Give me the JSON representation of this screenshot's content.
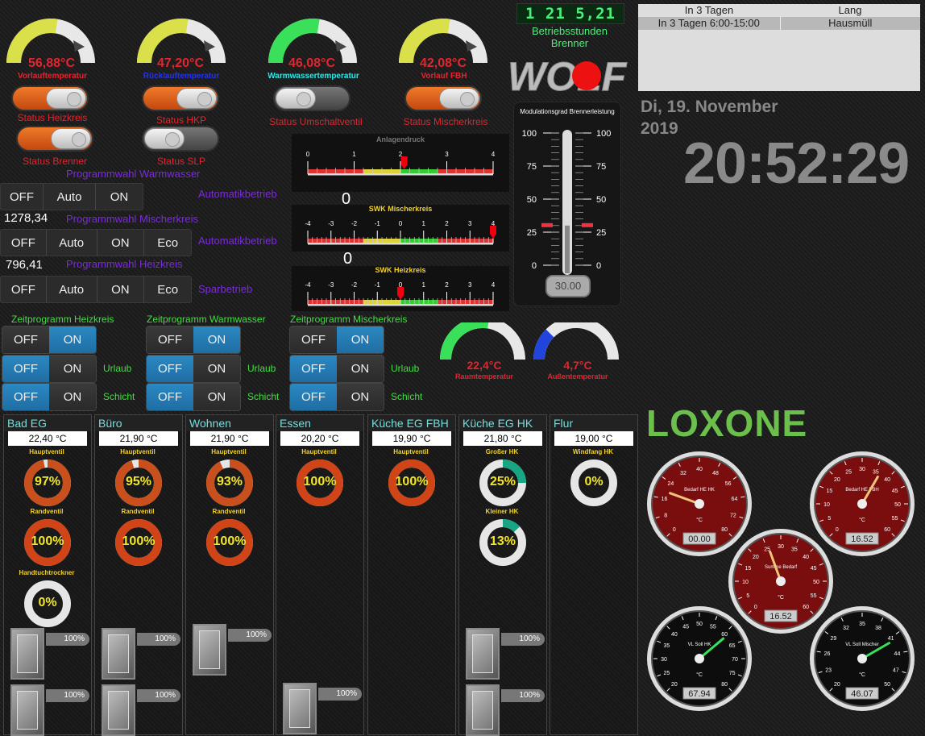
{
  "gauges_top": [
    {
      "value": "56,88°C",
      "label": "Vorlauftemperatur",
      "label_color": "#e0262f",
      "arc_color": "#d9e04a"
    },
    {
      "value": "47,20°C",
      "label": "Rücklauftemperatur",
      "label_color": "#2233ee",
      "arc_color": "#d9e04a"
    },
    {
      "value": "46,08°C",
      "label": "Warmwassertemperatur",
      "label_color": "#33e6e6",
      "arc_color": "#3be05a"
    },
    {
      "value": "42,08°C",
      "label": "Vorlauf FBH",
      "label_color": "#e0262f",
      "arc_color": "#d9e04a"
    }
  ],
  "status": {
    "heizkreis": "Status Heizkreis",
    "hkp": "Status HKP",
    "umschaltventil": "Status Umschaltventil",
    "mischerkreis": "Status Mischerkreis",
    "brenner": "Status Brenner",
    "slp": "Status SLP"
  },
  "counter": {
    "digits": "1 21 5,21",
    "label1": "Betriebsstunden",
    "label2": "Brenner"
  },
  "brand": {
    "wolf": "WOLF",
    "loxone": "LOXONE"
  },
  "calendar": {
    "col1": "In 3 Tagen",
    "col2": "Lang",
    "row_date": "In 3 Tagen 6:00-15:00",
    "row_value": "Hausmüll"
  },
  "datetime": {
    "date1": "Di, 19. November",
    "date2": "2019",
    "time": "20:52:29"
  },
  "programm": {
    "ww_title": "Programmwahl Warmwasser",
    "ww_buttons": [
      "OFF",
      "Auto",
      "ON"
    ],
    "ww_status": "Automatikbetrieb",
    "value1": "1278,34",
    "misch_title": "Programmwahl Mischerkreis",
    "misch_buttons": [
      "OFF",
      "Auto",
      "ON",
      "Eco"
    ],
    "misch_status": "Automatikbetrieb",
    "value2": "796,41",
    "heiz_title": "Programmwahl Heizkreis",
    "heiz_buttons": [
      "OFF",
      "Auto",
      "ON",
      "Eco"
    ],
    "heiz_status": "Sparbetrieb"
  },
  "scales": {
    "anlagendruck": {
      "title": "Anlagendruck",
      "ticks": [
        "0",
        "1",
        "2",
        "3",
        "4"
      ],
      "value": "0"
    },
    "swk_misch": {
      "title": "SWK Mischerkreis",
      "ticks": [
        "-4",
        "-3",
        "-2",
        "-1",
        "0",
        "1",
        "2",
        "3",
        "4"
      ],
      "value": "0"
    },
    "swk_heiz": {
      "title": "SWK Heizkreis",
      "ticks": [
        "-4",
        "-3",
        "-2",
        "-1",
        "0",
        "1",
        "2",
        "3",
        "4"
      ]
    }
  },
  "thermo": {
    "title": "Modulationsgrad Brennerleistung",
    "ticks": [
      "100",
      "75",
      "50",
      "25",
      "0"
    ],
    "value": "30.00",
    "level": 0.3
  },
  "zeitprogramm": {
    "heiz": "Zeitprogramm Heizkreis",
    "ww": "Zeitprogramm Warmwasser",
    "misch": "Zeitprogramm Mischerkreis",
    "off": "OFF",
    "on": "ON",
    "urlaub": "Urlaub",
    "schicht": "Schicht"
  },
  "small_gauges": [
    {
      "value": "22,4°C",
      "label": "Raumtemperatur",
      "arc_color": "#3be05a",
      "level": 0.55
    },
    {
      "value": "4,7°C",
      "label": "Außentemperatur",
      "arc_color": "#2244dd",
      "level": 0.25
    }
  ],
  "rooms": [
    {
      "name": "Bad EG",
      "temp": "22,40 °C",
      "rings": [
        {
          "label": "Hauptventil",
          "value": "97%",
          "level": 0.97
        },
        {
          "label": "Randventil",
          "value": "100%",
          "level": 1
        },
        {
          "label": "Handtuchtrockner",
          "value": "0%",
          "level": 0
        }
      ],
      "windows": [
        "100%",
        "100%"
      ]
    },
    {
      "name": "Büro",
      "temp": "21,90 °C",
      "rings": [
        {
          "label": "Hauptventil",
          "value": "95%",
          "level": 0.95
        },
        {
          "label": "Randventil",
          "value": "100%",
          "level": 1
        }
      ],
      "windows": [
        "100%",
        "100%"
      ]
    },
    {
      "name": "Wohnen",
      "temp": "21,90 °C",
      "rings": [
        {
          "label": "Hauptventil",
          "value": "93%",
          "level": 0.93
        },
        {
          "label": "Randventil",
          "value": "100%",
          "level": 1
        }
      ],
      "windows": [
        "100%"
      ]
    },
    {
      "name": "Essen",
      "temp": "20,20 °C",
      "rings": [
        {
          "label": "Hauptventil",
          "value": "100%",
          "level": 1
        }
      ],
      "windows": [
        "100%"
      ]
    },
    {
      "name": "Küche EG FBH",
      "temp": "19,90 °C",
      "rings": [
        {
          "label": "Hauptventil",
          "value": "100%",
          "level": 1
        }
      ],
      "windows": []
    },
    {
      "name": "Küche EG HK",
      "temp": "21,80 °C",
      "rings": [
        {
          "label": "Großer HK",
          "value": "25%",
          "level": 0.25
        },
        {
          "label": "Kleiner HK",
          "value": "13%",
          "level": 0.13
        }
      ],
      "windows": [
        "100%",
        "100%"
      ]
    },
    {
      "name": "Flur",
      "temp": "19,00 °C",
      "rings": [
        {
          "label": "Windfang HK",
          "value": "0%",
          "level": 0
        }
      ],
      "windows": []
    }
  ],
  "dials": [
    {
      "label": "Bedarf HE HK",
      "value": "00.00",
      "unit": "°C",
      "ticks": [
        "0",
        "8",
        "16",
        "24",
        "32",
        "40",
        "48",
        "56",
        "64",
        "72",
        "80"
      ],
      "face": "red"
    },
    {
      "label": "Bedarf HE FBH",
      "value": "16.52",
      "unit": "°C",
      "ticks": [
        "0",
        "5",
        "10",
        "15",
        "20",
        "25",
        "30",
        "35",
        "40",
        "45",
        "50",
        "55",
        "60"
      ],
      "face": "red"
    },
    {
      "label": "Summe Bedarf",
      "value": "16.52",
      "unit": "°C",
      "ticks": [
        "0",
        "5",
        "10",
        "15",
        "20",
        "25",
        "30",
        "35",
        "40",
        "45",
        "50",
        "55",
        "60"
      ],
      "face": "red"
    },
    {
      "label": "VL Soll HK",
      "value": "67.94",
      "unit": "°C",
      "ticks": [
        "20",
        "25",
        "30",
        "35",
        "40",
        "45",
        "50",
        "55",
        "60",
        "65",
        "70",
        "75",
        "80"
      ],
      "face": "black"
    },
    {
      "label": "VL Soll Mischer",
      "value": "46.07",
      "unit": "°C",
      "ticks": [
        "20",
        "23",
        "26",
        "29",
        "32",
        "35",
        "38",
        "41",
        "44",
        "47",
        "50"
      ],
      "face": "black"
    }
  ]
}
